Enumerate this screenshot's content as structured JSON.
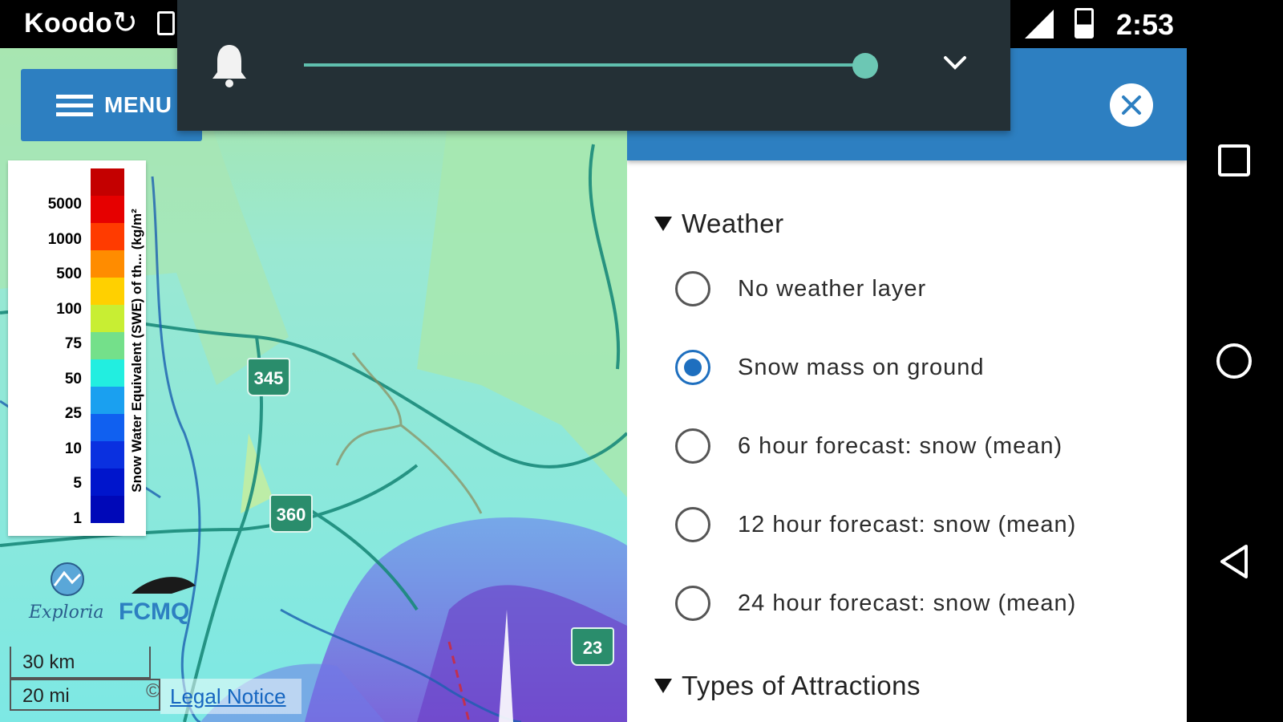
{
  "status_bar": {
    "carrier": "Koodo",
    "time": "2:53",
    "icons": [
      "sync-icon",
      "sim-icon",
      "signal-icon",
      "battery-icon"
    ]
  },
  "notification": {
    "icon": "bell-icon",
    "volume_level": 1.0,
    "expand_icon": "chevron-down-icon"
  },
  "map": {
    "menu_label": "MENU",
    "legend": {
      "title": "Snow Water Equivalent (SWE) of th... (kg/m²",
      "labels": [
        "5000",
        "1000",
        "500",
        "100",
        "75",
        "50",
        "25",
        "10",
        "5",
        "1"
      ],
      "colors": [
        "#c40000",
        "#e60000",
        "#ff3b00",
        "#ff8c00",
        "#ffd000",
        "#c8ee33",
        "#74e08a",
        "#22eee0",
        "#1aa0f0",
        "#1060f0",
        "#0a30e0",
        "#0015cc",
        "#0008b8"
      ]
    },
    "routes": [
      "345",
      "360",
      "23"
    ],
    "logos": [
      "Exploria",
      "FCMQ"
    ],
    "scale_km": "30 km",
    "scale_mi": "20 mi",
    "legal_notice": "Legal Notice",
    "copyright": "©"
  },
  "panel": {
    "sections": [
      {
        "title": "Weather",
        "options": [
          {
            "label": "No weather layer",
            "selected": false
          },
          {
            "label": "Snow mass on ground",
            "selected": true
          },
          {
            "label": "6 hour forecast: snow (mean)",
            "selected": false
          },
          {
            "label": "12 hour forecast: snow (mean)",
            "selected": false
          },
          {
            "label": "24 hour forecast: snow (mean)",
            "selected": false
          }
        ]
      },
      {
        "title": "Types of Attractions"
      }
    ],
    "close_icon": "close-icon"
  },
  "nav_bar": {
    "buttons": [
      "recents-icon",
      "home-icon",
      "back-icon"
    ]
  }
}
